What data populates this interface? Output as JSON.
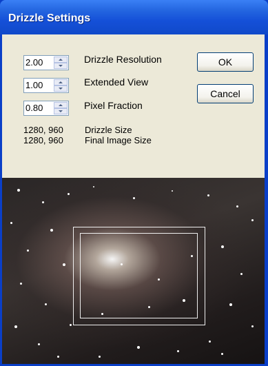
{
  "window": {
    "title": "Drizzle Settings"
  },
  "settings": {
    "resolution": {
      "value": "2.00",
      "label": "Drizzle Resolution"
    },
    "extended": {
      "value": "1.00",
      "label": "Extended View"
    },
    "pixel_fraction": {
      "value": "0.80",
      "label": "Pixel Fraction"
    }
  },
  "info": {
    "drizzle_size_value": "1280, 960",
    "drizzle_size_label": "Drizzle Size",
    "final_size_value": "1280, 960",
    "final_size_label": "Final Image Size"
  },
  "buttons": {
    "ok": "OK",
    "cancel": "Cancel"
  }
}
